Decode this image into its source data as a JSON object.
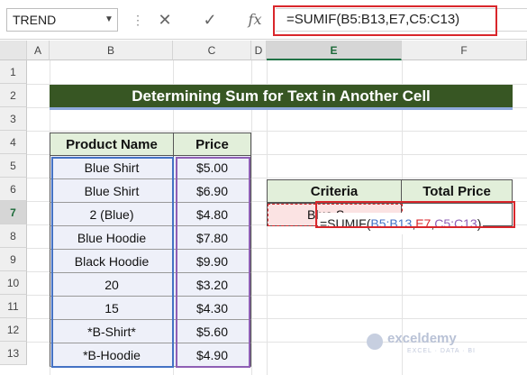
{
  "formula_bar": {
    "name_box": "TREND",
    "cancel_icon": "✕",
    "enter_icon": "✓",
    "fx_icon": "fx",
    "formula": "=SUMIF(B5:B13,E7,C5:C13)"
  },
  "columns": [
    "A",
    "B",
    "C",
    "D",
    "E",
    "F"
  ],
  "rows": [
    "1",
    "2",
    "3",
    "4",
    "5",
    "6",
    "7",
    "8",
    "9",
    "10",
    "11",
    "12",
    "13"
  ],
  "sheet": {
    "title": "Determining Sum for Text in Another Cell",
    "table": {
      "headers": [
        "Product Name",
        "Price"
      ],
      "rows": [
        [
          "Blue Shirt",
          "$5.00"
        ],
        [
          "Blue Shirt",
          "$6.90"
        ],
        [
          "2 (Blue)",
          "$4.80"
        ],
        [
          "Blue Hoodie",
          "$7.80"
        ],
        [
          "Black Hoodie",
          "$9.90"
        ],
        [
          "20",
          "$3.20"
        ],
        [
          "15",
          "$4.30"
        ],
        [
          "*B-Shirt*",
          "$5.60"
        ],
        [
          "*B-Hoodie",
          "$4.90"
        ]
      ]
    },
    "criteria_table": {
      "headers": [
        "Criteria",
        "Total Price"
      ],
      "criteria_value": "Blue S",
      "editing_formula": {
        "prefix": "=SUMIF(",
        "ref1": "B5:B13",
        "sep1": ",",
        "ref2": "E7",
        "sep2": ",",
        "ref3": "C5:C13",
        "suffix": ")"
      }
    }
  },
  "watermark": {
    "name": "exceldemy",
    "tagline": "EXCEL · DATA · BI"
  },
  "colors": {
    "title_bg": "#375623",
    "header_bg": "#e2efda",
    "highlight": "#d9262b",
    "ref_blue": "#4472c4",
    "ref_red": "#d9262b",
    "ref_purple": "#8f5fb5"
  }
}
